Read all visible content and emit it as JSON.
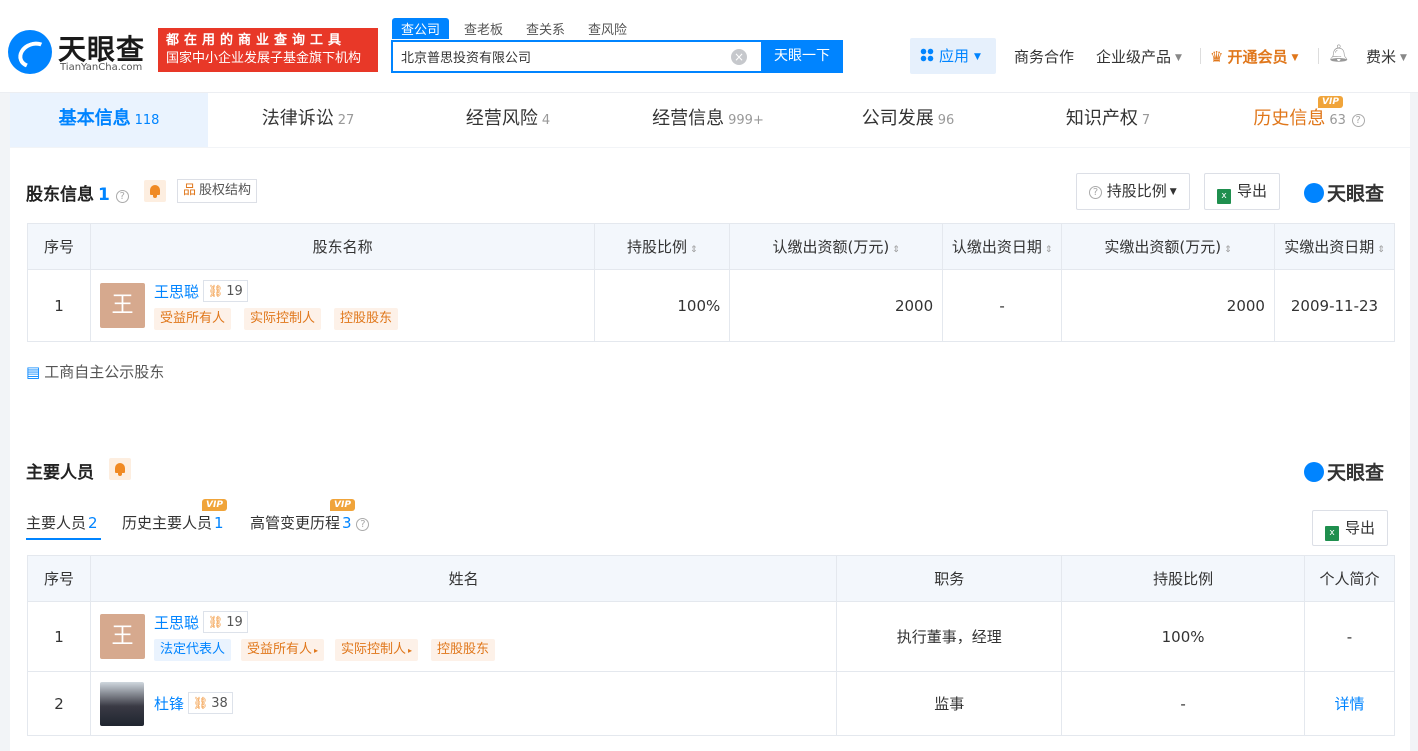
{
  "header": {
    "logo_text": "天眼查",
    "logo_sub": "TianYanCha.com",
    "slogan_line1": "都在用的商业查询工具",
    "slogan_line2": "国家中小企业发展子基金旗下机构",
    "search_tabs": [
      "查公司",
      "查老板",
      "查关系",
      "查风险"
    ],
    "search_value": "北京普思投资有限公司",
    "search_button": "天眼一下",
    "nav": {
      "app": "应用",
      "business": "商务合作",
      "enterprise": "企业级产品",
      "vip": "开通会员",
      "user": "费米"
    }
  },
  "main_tabs": [
    {
      "label": "基本信息",
      "count": "118"
    },
    {
      "label": "法律诉讼",
      "count": "27"
    },
    {
      "label": "经营风险",
      "count": "4"
    },
    {
      "label": "经营信息",
      "count": "999+"
    },
    {
      "label": "公司发展",
      "count": "96"
    },
    {
      "label": "知识产权",
      "count": "7"
    },
    {
      "label": "历史信息",
      "count": "63"
    }
  ],
  "vip_label": "VIP",
  "shareholders": {
    "title": "股东信息",
    "count": "1",
    "structure_btn": "股权结构",
    "ratio_btn": "持股比例",
    "export_btn": "导出",
    "brand": "天眼查",
    "headers": [
      "序号",
      "股东名称",
      "持股比例",
      "认缴出资额(万元)",
      "认缴出资日期",
      "实缴出资额(万元)",
      "实缴出资日期"
    ],
    "rows": [
      {
        "index": "1",
        "avatar": "王",
        "name": "王思聪",
        "relations": "19",
        "tags": [
          "受益所有人",
          "实际控制人",
          "控股股东"
        ],
        "ratio": "100%",
        "subscribed": "2000",
        "subscribed_date": "-",
        "paid": "2000",
        "paid_date": "2009-11-23"
      }
    ],
    "public_link": "工商自主公示股东"
  },
  "personnel": {
    "title": "主要人员",
    "brand": "天眼查",
    "export_btn": "导出",
    "sub_tabs": [
      {
        "label": "主要人员",
        "count": "2"
      },
      {
        "label": "历史主要人员",
        "count": "1"
      },
      {
        "label": "高管变更历程",
        "count": "3"
      }
    ],
    "headers": [
      "序号",
      "姓名",
      "职务",
      "持股比例",
      "个人简介"
    ],
    "rows": [
      {
        "index": "1",
        "avatar": "王",
        "name": "王思聪",
        "relations": "19",
        "tags": [
          "法定代表人",
          "受益所有人",
          "实际控制人",
          "控股股东"
        ],
        "position": "执行董事，经理",
        "ratio": "100%",
        "bio": "-"
      },
      {
        "index": "2",
        "name": "杜锋",
        "relations": "38",
        "tags": [],
        "position": "监事",
        "ratio": "-",
        "bio": "详情"
      }
    ]
  }
}
